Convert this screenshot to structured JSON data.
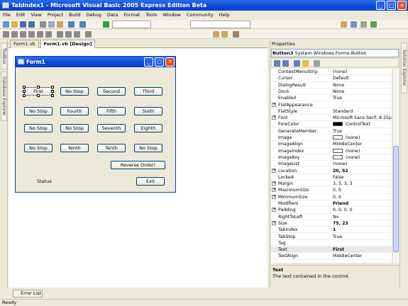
{
  "window": {
    "title": "TabIndex1 - Microsoft Visual Basic 2005 Express Edition Beta",
    "min": "_",
    "max": "□",
    "close": "×"
  },
  "menu": [
    "File",
    "Edit",
    "View",
    "Project",
    "Build",
    "Debug",
    "Data",
    "Format",
    "Tools",
    "Window",
    "Community",
    "Help"
  ],
  "tabs": {
    "code": "Form1.vb",
    "design": "Form1.vb [Design]"
  },
  "left_tabs": {
    "toolbox": "Toolbox",
    "db": "Database Explorer"
  },
  "right_tabs": {
    "solution": "Solution Explorer"
  },
  "form": {
    "title": "Form1",
    "buttons": [
      {
        "label": "First",
        "selected": true
      },
      {
        "label": "No Stop"
      },
      {
        "label": "Second"
      },
      {
        "label": "Third"
      },
      {
        "label": "No Stop"
      },
      {
        "label": "Fourth"
      },
      {
        "label": "Fifth"
      },
      {
        "label": "Sixth"
      },
      {
        "label": "No Stop"
      },
      {
        "label": "No Stop"
      },
      {
        "label": "Seventh"
      },
      {
        "label": "Eighth"
      },
      {
        "label": "No Stop"
      },
      {
        "label": "Ninth"
      },
      {
        "label": "Tenth"
      },
      {
        "label": "No Stop"
      }
    ],
    "reverse": "Reverse Order!",
    "status": "Status",
    "exit": "Exit"
  },
  "properties": {
    "header": "Properties",
    "object": "Button3",
    "object_type": "System.Windows.Forms.Button",
    "rows": [
      {
        "name": "ContextMenuStrip",
        "value": "(none)"
      },
      {
        "name": "Cursor",
        "value": "Default"
      },
      {
        "name": "DialogResult",
        "value": "None"
      },
      {
        "name": "Dock",
        "value": "None"
      },
      {
        "name": "Enabled",
        "value": "True"
      },
      {
        "name": "FlatAppearance",
        "value": "",
        "exp": "+"
      },
      {
        "name": "FlatStyle",
        "value": "Standard"
      },
      {
        "name": "Font",
        "value": "Microsoft Sans Serif, 8.25pt",
        "exp": "+"
      },
      {
        "name": "ForeColor",
        "value": "ControlText",
        "swatch": "#000000"
      },
      {
        "name": "GenerateMember",
        "value": "True"
      },
      {
        "name": "Image",
        "value": "(none)",
        "swatch": "#ffffff"
      },
      {
        "name": "ImageAlign",
        "value": "MiddleCenter"
      },
      {
        "name": "ImageIndex",
        "value": "(none)",
        "swatch": "#ffffff"
      },
      {
        "name": "ImageKey",
        "value": "(none)",
        "swatch": "#ffffff"
      },
      {
        "name": "ImageList",
        "value": "(none)"
      },
      {
        "name": "Location",
        "value": "20, 52",
        "exp": "+",
        "bold": true
      },
      {
        "name": "Locked",
        "value": "False"
      },
      {
        "name": "Margin",
        "value": "3, 3, 3, 3",
        "exp": "+"
      },
      {
        "name": "MaximumSize",
        "value": "0, 0",
        "exp": "+"
      },
      {
        "name": "MinimumSize",
        "value": "0, 0",
        "exp": "+"
      },
      {
        "name": "Modifiers",
        "value": "Friend",
        "bold": true
      },
      {
        "name": "Padding",
        "value": "0, 0, 0, 0",
        "exp": "+"
      },
      {
        "name": "RightToLeft",
        "value": "No"
      },
      {
        "name": "Size",
        "value": "75, 23",
        "exp": "+",
        "bold": true
      },
      {
        "name": "TabIndex",
        "value": "1",
        "bold": true
      },
      {
        "name": "TabStop",
        "value": "True"
      },
      {
        "name": "Tag",
        "value": ""
      },
      {
        "name": "Text",
        "value": "First",
        "bold": true,
        "selected": true
      },
      {
        "name": "TextAlign",
        "value": "MiddleCenter"
      }
    ],
    "desc_title": "Text",
    "desc_text": "The text contained in the control."
  },
  "error_list": "Error List",
  "status": "Ready"
}
